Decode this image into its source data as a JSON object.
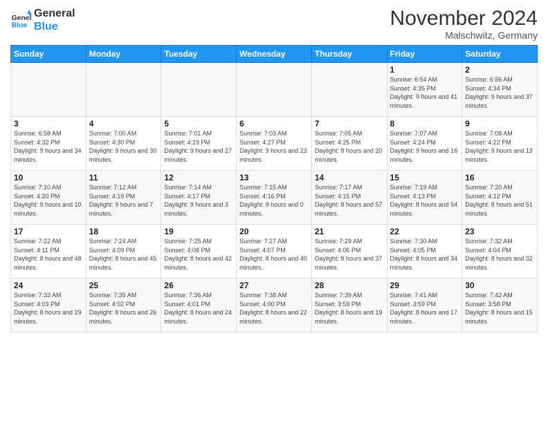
{
  "header": {
    "logo_line1": "General",
    "logo_line2": "Blue",
    "month": "November 2024",
    "location": "Malschwitz, Germany"
  },
  "weekdays": [
    "Sunday",
    "Monday",
    "Tuesday",
    "Wednesday",
    "Thursday",
    "Friday",
    "Saturday"
  ],
  "weeks": [
    [
      {
        "day": "",
        "info": ""
      },
      {
        "day": "",
        "info": ""
      },
      {
        "day": "",
        "info": ""
      },
      {
        "day": "",
        "info": ""
      },
      {
        "day": "",
        "info": ""
      },
      {
        "day": "1",
        "info": "Sunrise: 6:54 AM\nSunset: 4:35 PM\nDaylight: 9 hours and 41 minutes."
      },
      {
        "day": "2",
        "info": "Sunrise: 6:56 AM\nSunset: 4:34 PM\nDaylight: 9 hours and 37 minutes."
      }
    ],
    [
      {
        "day": "3",
        "info": "Sunrise: 6:58 AM\nSunset: 4:32 PM\nDaylight: 9 hours and 34 minutes."
      },
      {
        "day": "4",
        "info": "Sunrise: 7:00 AM\nSunset: 4:30 PM\nDaylight: 9 hours and 30 minutes."
      },
      {
        "day": "5",
        "info": "Sunrise: 7:01 AM\nSunset: 4:29 PM\nDaylight: 9 hours and 27 minutes."
      },
      {
        "day": "6",
        "info": "Sunrise: 7:03 AM\nSunset: 4:27 PM\nDaylight: 9 hours and 23 minutes."
      },
      {
        "day": "7",
        "info": "Sunrise: 7:05 AM\nSunset: 4:25 PM\nDaylight: 9 hours and 20 minutes."
      },
      {
        "day": "8",
        "info": "Sunrise: 7:07 AM\nSunset: 4:24 PM\nDaylight: 9 hours and 16 minutes."
      },
      {
        "day": "9",
        "info": "Sunrise: 7:08 AM\nSunset: 4:22 PM\nDaylight: 9 hours and 13 minutes."
      }
    ],
    [
      {
        "day": "10",
        "info": "Sunrise: 7:10 AM\nSunset: 4:20 PM\nDaylight: 9 hours and 10 minutes."
      },
      {
        "day": "11",
        "info": "Sunrise: 7:12 AM\nSunset: 4:19 PM\nDaylight: 9 hours and 7 minutes."
      },
      {
        "day": "12",
        "info": "Sunrise: 7:14 AM\nSunset: 4:17 PM\nDaylight: 9 hours and 3 minutes."
      },
      {
        "day": "13",
        "info": "Sunrise: 7:15 AM\nSunset: 4:16 PM\nDaylight: 9 hours and 0 minutes."
      },
      {
        "day": "14",
        "info": "Sunrise: 7:17 AM\nSunset: 4:15 PM\nDaylight: 8 hours and 57 minutes."
      },
      {
        "day": "15",
        "info": "Sunrise: 7:19 AM\nSunset: 4:13 PM\nDaylight: 8 hours and 54 minutes."
      },
      {
        "day": "16",
        "info": "Sunrise: 7:20 AM\nSunset: 4:12 PM\nDaylight: 8 hours and 51 minutes."
      }
    ],
    [
      {
        "day": "17",
        "info": "Sunrise: 7:22 AM\nSunset: 4:11 PM\nDaylight: 8 hours and 48 minutes."
      },
      {
        "day": "18",
        "info": "Sunrise: 7:24 AM\nSunset: 4:09 PM\nDaylight: 8 hours and 45 minutes."
      },
      {
        "day": "19",
        "info": "Sunrise: 7:25 AM\nSunset: 4:08 PM\nDaylight: 8 hours and 42 minutes."
      },
      {
        "day": "20",
        "info": "Sunrise: 7:27 AM\nSunset: 4:07 PM\nDaylight: 8 hours and 40 minutes."
      },
      {
        "day": "21",
        "info": "Sunrise: 7:29 AM\nSunset: 4:06 PM\nDaylight: 8 hours and 37 minutes."
      },
      {
        "day": "22",
        "info": "Sunrise: 7:30 AM\nSunset: 4:05 PM\nDaylight: 8 hours and 34 minutes."
      },
      {
        "day": "23",
        "info": "Sunrise: 7:32 AM\nSunset: 4:04 PM\nDaylight: 8 hours and 32 minutes."
      }
    ],
    [
      {
        "day": "24",
        "info": "Sunrise: 7:33 AM\nSunset: 4:03 PM\nDaylight: 8 hours and 29 minutes."
      },
      {
        "day": "25",
        "info": "Sunrise: 7:35 AM\nSunset: 4:02 PM\nDaylight: 8 hours and 26 minutes."
      },
      {
        "day": "26",
        "info": "Sunrise: 7:36 AM\nSunset: 4:01 PM\nDaylight: 8 hours and 24 minutes."
      },
      {
        "day": "27",
        "info": "Sunrise: 7:38 AM\nSunset: 4:00 PM\nDaylight: 8 hours and 22 minutes."
      },
      {
        "day": "28",
        "info": "Sunrise: 7:39 AM\nSunset: 3:59 PM\nDaylight: 8 hours and 19 minutes."
      },
      {
        "day": "29",
        "info": "Sunrise: 7:41 AM\nSunset: 3:59 PM\nDaylight: 8 hours and 17 minutes."
      },
      {
        "day": "30",
        "info": "Sunrise: 7:42 AM\nSunset: 3:58 PM\nDaylight: 8 hours and 15 minutes."
      }
    ]
  ]
}
